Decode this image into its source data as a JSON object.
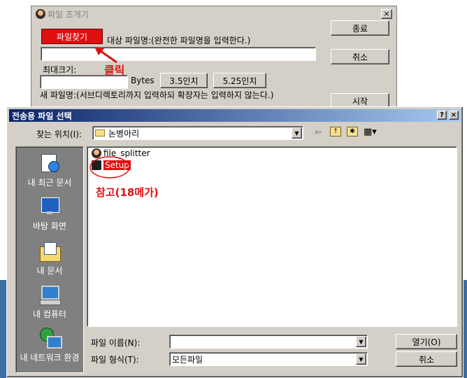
{
  "splitter": {
    "title": "파일 조개기",
    "close": "×",
    "find_button": "파일찾기",
    "target_label": "대상 파일명:(완전한 파일명을 입력한다.)",
    "end_button": "종료",
    "cancel_button": "취소",
    "start_button": "시작",
    "max_size_label": "최대크기:",
    "bytes_label": "Bytes",
    "inch35_button": "3.5인치",
    "inch525_button": "5.25인치",
    "new_name_label": "새 파일명:(서브디렉토리까지 입력하되 확장자는 입력하지 않는다.)",
    "click_note": "클릭"
  },
  "dialog": {
    "title": "전송용 파일 선택",
    "help_btn": "?",
    "close_btn": "×",
    "look_in_label": "찾는 위치(I):",
    "look_in_value": "논병아리",
    "places": [
      {
        "label": "내 최근 문서",
        "icon": "recent-documents-icon"
      },
      {
        "label": "바탕 화면",
        "icon": "desktop-icon"
      },
      {
        "label": "내 문서",
        "icon": "my-documents-icon"
      },
      {
        "label": "내 컴퓨터",
        "icon": "my-computer-icon"
      },
      {
        "label": "내 네트워크 환경",
        "icon": "network-icon"
      }
    ],
    "files": [
      {
        "name": "file_splitter",
        "icon": "app-icon"
      },
      {
        "name": "Setup",
        "icon": "setup-icon"
      }
    ],
    "note": "참고(18메가)",
    "filename_label": "파일 이름(N):",
    "filename_value": "",
    "filetype_label": "파일 형식(T):",
    "filetype_value": "모든파일",
    "open_button": "열기(O)",
    "cancel_button": "취소"
  }
}
